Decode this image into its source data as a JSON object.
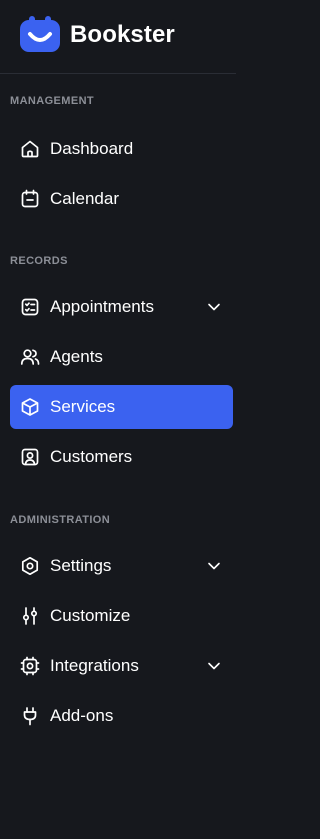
{
  "brand": {
    "name": "Bookster"
  },
  "colors": {
    "background": "#16181d",
    "accent": "#3b62f0",
    "section_label": "#8c8f97"
  },
  "sections": {
    "management": {
      "label": "MANAGEMENT",
      "items": [
        {
          "label": "Dashboard",
          "icon": "home-icon"
        },
        {
          "label": "Calendar",
          "icon": "calendar-icon"
        }
      ]
    },
    "records": {
      "label": "RECORDS",
      "items": [
        {
          "label": "Appointments",
          "icon": "checklist-icon",
          "has_submenu": true
        },
        {
          "label": "Agents",
          "icon": "users-icon"
        },
        {
          "label": "Services",
          "icon": "box-icon",
          "active": true
        },
        {
          "label": "Customers",
          "icon": "user-card-icon"
        }
      ]
    },
    "administration": {
      "label": "ADMINISTRATION",
      "items": [
        {
          "label": "Settings",
          "icon": "hexagon-settings-icon",
          "has_submenu": true
        },
        {
          "label": "Customize",
          "icon": "sliders-icon"
        },
        {
          "label": "Integrations",
          "icon": "cpu-icon",
          "has_submenu": true
        },
        {
          "label": "Add-ons",
          "icon": "plug-icon"
        }
      ]
    }
  }
}
